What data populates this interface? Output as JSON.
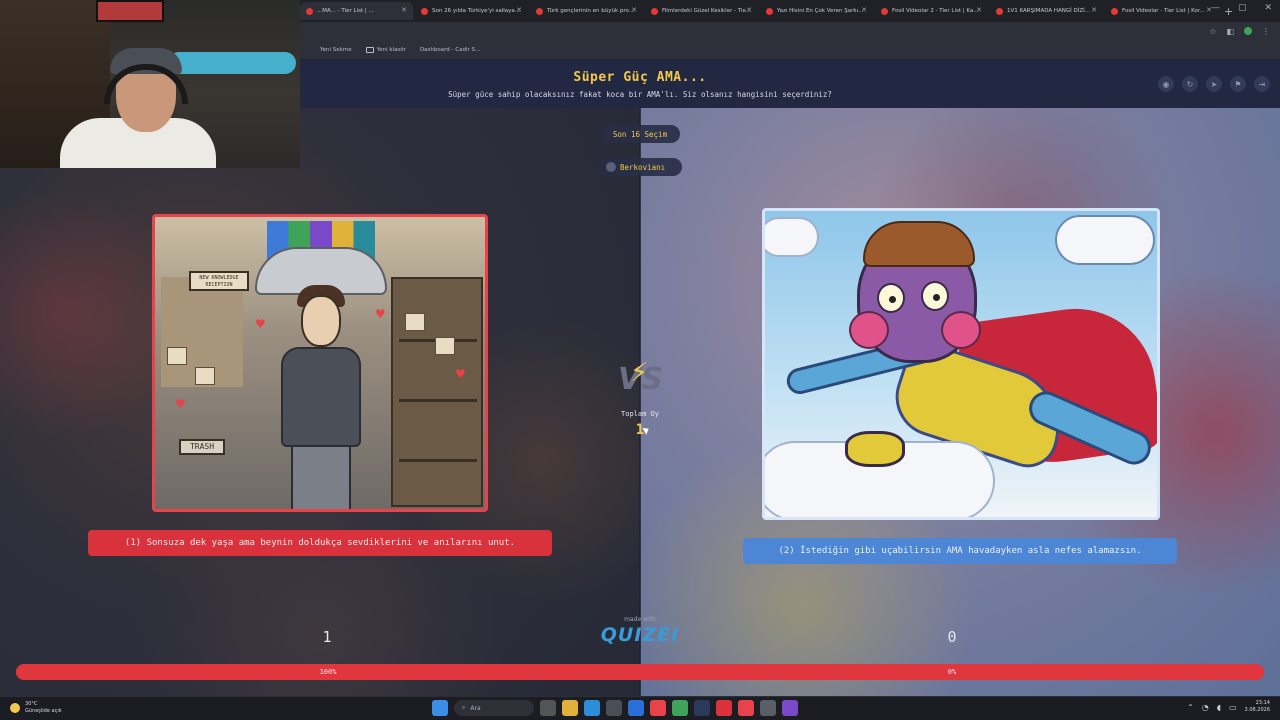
{
  "browser": {
    "tabs": [
      {
        "label": "...MA... - Tier List | ..."
      },
      {
        "label": "Son 26 yılda Türkiye'yi sallaya..."
      },
      {
        "label": "Türk gençlerinin en büyük pro..."
      },
      {
        "label": "Filmlerdeki Güzel Kesikler - Tie..."
      },
      {
        "label": "Yazı Hisini En Çok Veren Şarkı..."
      },
      {
        "label": "Fosil Videolar 2 - Tier List | Ka..."
      },
      {
        "label": "1V1 KARŞIMADA HANGİ DİZİ..."
      },
      {
        "label": "Fosil Videolar - Tier List | Kor..."
      }
    ],
    "new_tab": "+",
    "window_controls": [
      "—",
      "▢",
      "✕"
    ],
    "bookmarks": [
      "Yeni Sekme",
      "Yeni klasör",
      "Dashboard - Cadir S..."
    ]
  },
  "header": {
    "title": "Süper Güç AMA...",
    "subtitle": "Süper güce sahip olacaksınız fakat koca bir AMA'lı. Siz olsanız hangisini seçerdiniz?",
    "actions": [
      "eye-icon",
      "refresh-icon",
      "send-icon",
      "flag-icon",
      "exit-icon"
    ]
  },
  "round_label": "Son 16 Seçim",
  "user_name": "Berkovianı",
  "options": [
    {
      "caption": "(1) Sonsuza dek yaşa ama beynin doldukça sevdiklerini ve anılarını unut.",
      "image_texts": [
        "NEW KNOWLEDGE RECEPTION",
        "TRASH"
      ],
      "votes": "1",
      "percent": "100%",
      "percent_value": 100,
      "border_color": "#e8434b"
    },
    {
      "caption": "(2) İstediğin gibi uçabilirsin AMA havadayken asla nefes alamazsın.",
      "votes": "0",
      "percent": "0%",
      "percent_value": 0,
      "border_color": "#d8e4f8"
    }
  ],
  "vs_label": "VS",
  "total_label": "Toplam Oy",
  "total_value": "1",
  "made_with": "made with",
  "brand": "QUIZEI",
  "taskbar": {
    "weather_temp": "30°C",
    "weather_desc": "Güneşlide açık",
    "search_placeholder": "Ara",
    "time": "23:14",
    "date": "3.08.2026"
  },
  "colors": {
    "accent_yellow": "#f2c94c",
    "option1_red": "#d9323c",
    "option2_blue": "#4e86d6",
    "header_bg": "#222842"
  }
}
